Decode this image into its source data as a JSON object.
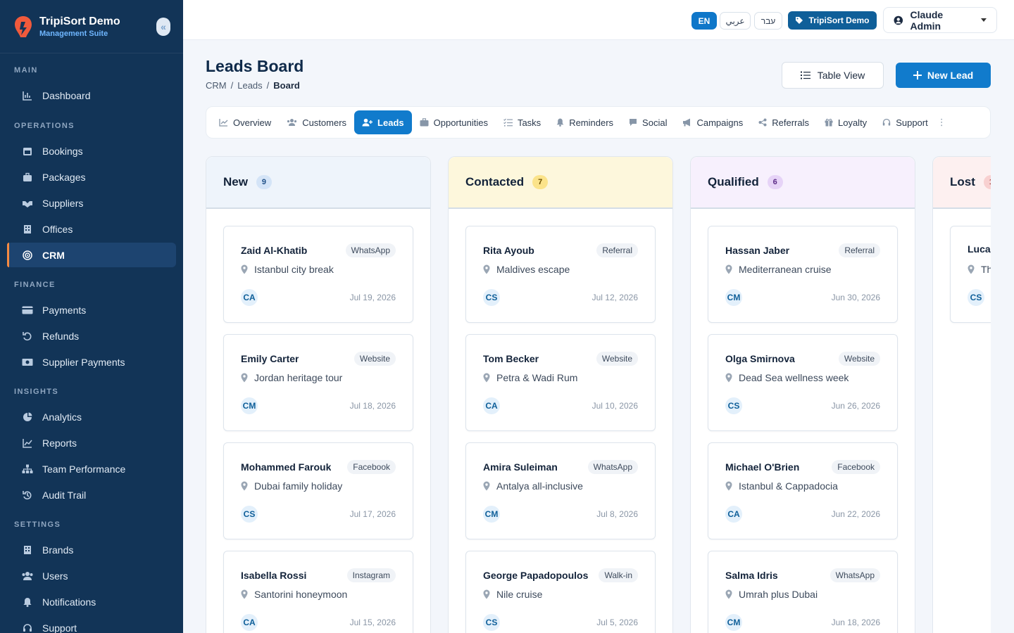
{
  "app": {
    "title": "TripiSort Demo",
    "subtitle": "Management Suite",
    "collapse_icon": "double-chevron-left-icon"
  },
  "sidebar": {
    "sections": [
      {
        "label": "MAIN",
        "items": [
          {
            "label": "Dashboard",
            "icon": "dashboard-icon"
          }
        ]
      },
      {
        "label": "OPERATIONS",
        "items": [
          {
            "label": "Bookings",
            "icon": "calendar-icon"
          },
          {
            "label": "Packages",
            "icon": "briefcase-icon"
          },
          {
            "label": "Suppliers",
            "icon": "handshake-icon"
          },
          {
            "label": "Offices",
            "icon": "building-icon"
          },
          {
            "label": "CRM",
            "icon": "target-icon",
            "active": true
          }
        ]
      },
      {
        "label": "FINANCE",
        "items": [
          {
            "label": "Payments",
            "icon": "credit-card-icon"
          },
          {
            "label": "Refunds",
            "icon": "undo-icon"
          },
          {
            "label": "Supplier Payments",
            "icon": "money-icon"
          }
        ]
      },
      {
        "label": "INSIGHTS",
        "items": [
          {
            "label": "Analytics",
            "icon": "pie-chart-icon"
          },
          {
            "label": "Reports",
            "icon": "line-chart-icon"
          },
          {
            "label": "Team Performance",
            "icon": "sitemap-icon"
          },
          {
            "label": "Audit Trail",
            "icon": "history-icon"
          }
        ]
      },
      {
        "label": "SETTINGS",
        "items": [
          {
            "label": "Brands",
            "icon": "building-icon"
          },
          {
            "label": "Users",
            "icon": "users-icon"
          },
          {
            "label": "Notifications",
            "icon": "bell-icon"
          },
          {
            "label": "Support",
            "icon": "headset-icon"
          }
        ]
      }
    ]
  },
  "topbar": {
    "languages": [
      {
        "label": "EN",
        "active": true
      },
      {
        "label": "عربي",
        "active": false
      },
      {
        "label": "עבר",
        "active": false
      }
    ],
    "brand_chip": "TripiSort Demo",
    "user": "Claude Admin"
  },
  "page": {
    "title": "Leads Board",
    "breadcrumb": [
      "CRM",
      "Leads",
      "Board"
    ],
    "table_view_label": "Table View",
    "new_lead_label": "New Lead"
  },
  "tabs": [
    {
      "label": "Overview",
      "icon": "chart-line-icon"
    },
    {
      "label": "Customers",
      "icon": "users-icon"
    },
    {
      "label": "Leads",
      "icon": "user-plus-icon",
      "active": true
    },
    {
      "label": "Opportunities",
      "icon": "briefcase-icon"
    },
    {
      "label": "Tasks",
      "icon": "list-check-icon"
    },
    {
      "label": "Reminders",
      "icon": "bell-icon"
    },
    {
      "label": "Social",
      "icon": "comment-icon"
    },
    {
      "label": "Campaigns",
      "icon": "bullhorn-icon"
    },
    {
      "label": "Referrals",
      "icon": "share-icon"
    },
    {
      "label": "Loyalty",
      "icon": "gift-icon"
    },
    {
      "label": "Support",
      "icon": "headset-icon"
    }
  ],
  "columns": [
    {
      "title": "New",
      "count": "9",
      "head_bg": "#eef4fb",
      "badge_bg": "#d4e4f7",
      "badge_color": "#1f4f86",
      "cards": [
        {
          "name": "Zaid Al-Khatib",
          "source": "WhatsApp",
          "trip": "Istanbul city break",
          "initials": "CA",
          "date": "Jul 19, 2026"
        },
        {
          "name": "Emily Carter",
          "source": "Website",
          "trip": "Jordan heritage tour",
          "initials": "CM",
          "date": "Jul 18, 2026"
        },
        {
          "name": "Mohammed Farouk",
          "source": "Facebook",
          "trip": "Dubai family holiday",
          "initials": "CS",
          "date": "Jul 17, 2026"
        },
        {
          "name": "Isabella Rossi",
          "source": "Instagram",
          "trip": "Santorini honeymoon",
          "initials": "CA",
          "date": "Jul 15, 2026"
        }
      ]
    },
    {
      "title": "Contacted",
      "count": "7",
      "head_bg": "#fdf7dc",
      "badge_bg": "#fbe38a",
      "badge_color": "#6b4e00",
      "cards": [
        {
          "name": "Rita Ayoub",
          "source": "Referral",
          "trip": "Maldives escape",
          "initials": "CS",
          "date": "Jul 12, 2026"
        },
        {
          "name": "Tom Becker",
          "source": "Website",
          "trip": "Petra & Wadi Rum",
          "initials": "CA",
          "date": "Jul 10, 2026"
        },
        {
          "name": "Amira Suleiman",
          "source": "WhatsApp",
          "trip": "Antalya all-inclusive",
          "initials": "CM",
          "date": "Jul 8, 2026"
        },
        {
          "name": "George Papadopoulos",
          "source": "Walk-in",
          "trip": "Nile cruise",
          "initials": "CS",
          "date": "Jul 5, 2026"
        }
      ]
    },
    {
      "title": "Qualified",
      "count": "6",
      "head_bg": "#f7f0fd",
      "badge_bg": "#e6d3f7",
      "badge_color": "#5b2a86",
      "cards": [
        {
          "name": "Hassan Jaber",
          "source": "Referral",
          "trip": "Mediterranean cruise",
          "initials": "CM",
          "date": "Jun 30, 2026"
        },
        {
          "name": "Olga Smirnova",
          "source": "Website",
          "trip": "Dead Sea wellness week",
          "initials": "CS",
          "date": "Jun 26, 2026"
        },
        {
          "name": "Michael O'Brien",
          "source": "Facebook",
          "trip": "Istanbul & Cappadocia",
          "initials": "CA",
          "date": "Jun 22, 2026"
        },
        {
          "name": "Salma Idris",
          "source": "WhatsApp",
          "trip": "Umrah plus Dubai",
          "initials": "CM",
          "date": "Jun 18, 2026"
        }
      ]
    },
    {
      "title": "Lost",
      "count": "1",
      "head_bg": "#fdf0f0",
      "badge_bg": "#f8d0d0",
      "badge_color": "#8a1f1f",
      "cards": [
        {
          "name": "Luca",
          "source": "",
          "trip": "Th",
          "initials": "CS",
          "date": ""
        }
      ]
    }
  ],
  "colors": {
    "sidebar_bg": "#123457",
    "accent": "#117bcc",
    "active_marker": "#f58a42"
  }
}
